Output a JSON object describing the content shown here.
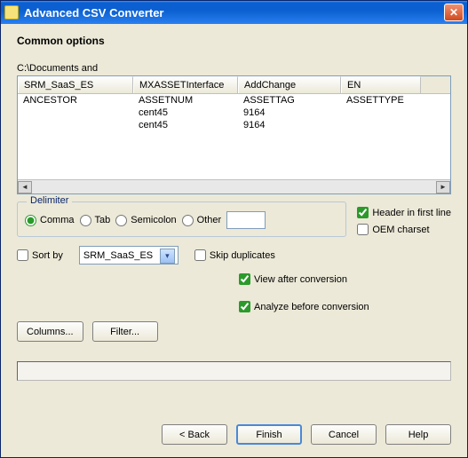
{
  "window": {
    "title": "Advanced CSV Converter"
  },
  "section_title": "Common options",
  "path": "C:\\Documents and",
  "table": {
    "headers": [
      "SRM_SaaS_ES",
      "MXASSETInterface",
      "AddChange",
      "EN"
    ],
    "rows": [
      [
        "ANCESTOR",
        "ASSETNUM",
        "ASSETTAG",
        "ASSETTYPE"
      ],
      [
        "",
        "cent45",
        "9164",
        ""
      ],
      [
        "",
        "cent45",
        "9164",
        ""
      ]
    ]
  },
  "delimiter": {
    "legend": "Delimiter",
    "options": {
      "comma": "Comma",
      "tab": "Tab",
      "semicolon": "Semicolon",
      "other": "Other"
    },
    "other_value": ""
  },
  "checks": {
    "header_first_line": "Header in first line",
    "oem_charset": "OEM charset",
    "sort_by": "Sort by",
    "skip_duplicates": "Skip duplicates",
    "view_after": "View after conversion",
    "analyze_before": "Analyze before conversion"
  },
  "sort_field": "SRM_SaaS_ES",
  "buttons": {
    "columns": "Columns...",
    "filter": "Filter...",
    "back": "< Back",
    "finish": "Finish",
    "cancel": "Cancel",
    "help": "Help"
  }
}
